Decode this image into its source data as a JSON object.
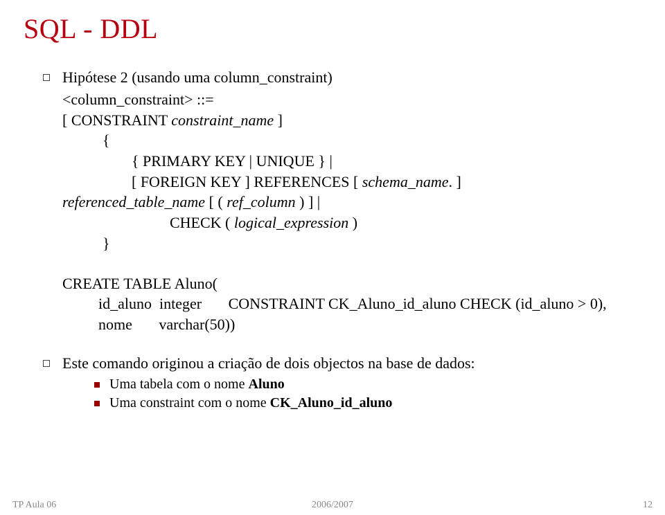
{
  "title": "SQL - DDL",
  "bullets": {
    "b1": "Hipótese 2 (usando uma column_constraint)",
    "b2": "Este comando originou a criação de dois objectos na base de dados:",
    "s1_pre": "Uma tabela com o nome ",
    "s1_bold": "Aluno",
    "s2_pre": "Uma ",
    "s2_italic": "constraint",
    "s2_mid": " com o nome ",
    "s2_bold": "CK_Aluno_id_aluno"
  },
  "syntax": {
    "l1": "<column_constraint> ::=",
    "l2a": "[ CONSTRAINT ",
    "l2b": "constraint_name",
    "l2c": " ]",
    "l3": "{",
    "l4": "{ PRIMARY KEY | UNIQUE } |",
    "l5a": "[ FOREIGN KEY ] REFERENCES [ ",
    "l5b": "schema_name",
    "l5c": ". ]",
    "l6a": "referenced_table_name",
    "l6b": " [ ( ",
    "l6c": "ref_column",
    "l6d": " ) ] |",
    "l7a": "CHECK ( ",
    "l7b": "logical_expression",
    "l7c": " )",
    "l8": "}"
  },
  "code": {
    "c1": "CREATE TABLE Aluno(",
    "c2": "id_aluno  integer       CONSTRAINT CK_Aluno_id_aluno CHECK (id_aluno > 0),",
    "c3": "nome       varchar(50))"
  },
  "footer": {
    "left": "TP Aula 06",
    "center": "2006/2007",
    "right": "12"
  }
}
